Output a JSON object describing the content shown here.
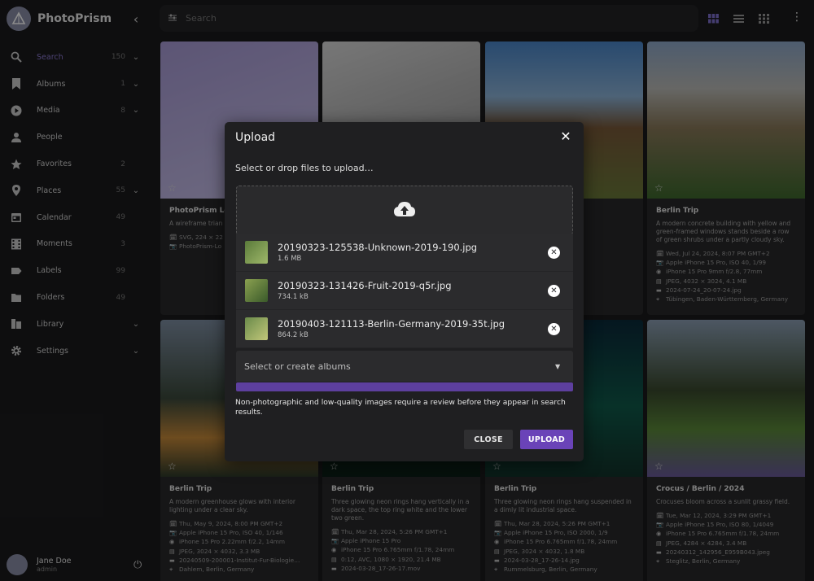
{
  "app": {
    "name": "PhotoPrism"
  },
  "nav": [
    {
      "key": "search",
      "label": "Search",
      "count": "150",
      "chevron": true,
      "active": true
    },
    {
      "key": "albums",
      "label": "Albums",
      "count": "1",
      "chevron": true
    },
    {
      "key": "media",
      "label": "Media",
      "count": "8",
      "chevron": true
    },
    {
      "key": "people",
      "label": "People",
      "count": "",
      "chevron": false
    },
    {
      "key": "favorites",
      "label": "Favorites",
      "count": "2",
      "chevron": false
    },
    {
      "key": "places",
      "label": "Places",
      "count": "55",
      "chevron": true
    },
    {
      "key": "calendar",
      "label": "Calendar",
      "count": "49",
      "chevron": false
    },
    {
      "key": "moments",
      "label": "Moments",
      "count": "3",
      "chevron": false
    },
    {
      "key": "labels",
      "label": "Labels",
      "count": "99",
      "chevron": false
    },
    {
      "key": "folders",
      "label": "Folders",
      "count": "49",
      "chevron": false
    },
    {
      "key": "library",
      "label": "Library",
      "count": "",
      "chevron": true
    },
    {
      "key": "settings",
      "label": "Settings",
      "count": "",
      "chevron": true
    }
  ],
  "user": {
    "name": "Jane Doe",
    "role": "admin"
  },
  "topbar": {
    "search_placeholder": "Search"
  },
  "cards": [
    {
      "title": "PhotoPrism Lo",
      "desc": "A wireframe trian sional geometric",
      "meta": [
        "SVG, 224 × 22",
        "PhotoPrism-Lo"
      ]
    },
    {
      "title": "",
      "desc": "",
      "meta": []
    },
    {
      "title": "",
      "desc": "columns and to the distance",
      "meta": [
        "GMT+2",
        "80, 1/2833",
        "1.78, 24mm",
        "3"
      ]
    },
    {
      "title": "Berlin Trip",
      "desc": "A modern concrete building with yellow and green-framed windows stands beside a row of green shrubs under a partly cloudy sky.",
      "meta": [
        "Wed, Jul 24, 2024, 8:07 PM GMT+2",
        "Apple iPhone 15 Pro, ISO 40, 1/99",
        "iPhone 15 Pro 9mm f/2.8, 77mm",
        "JPEG, 4032 × 3024, 4.1 MB",
        "2024-07-24_20-07-24.jpg",
        "Tübingen, Baden-Württemberg, Germany"
      ]
    },
    {
      "title": "Berlin Trip",
      "desc": "A modern greenhouse glows with interior lighting under a clear sky.",
      "meta": [
        "Thu, May 9, 2024, 8:00 PM GMT+2",
        "Apple iPhone 15 Pro, ISO 40, 1/146",
        "iPhone 15 Pro 2.22mm f/2.2, 14mm",
        "JPEG, 3024 × 4032, 3.3 MB",
        "20240509-200001-Institut-Fur-Biologie…",
        "Dahlem, Berlin, Germany"
      ]
    },
    {
      "title": "Berlin Trip",
      "desc": "Three glowing neon rings hang vertically in a dark space, the top ring white and the lower two green.",
      "meta": [
        "Thu, Mar 28, 2024, 5:26 PM GMT+1",
        "Apple iPhone 15 Pro",
        "iPhone 15 Pro 6.765mm f/1.78, 24mm",
        "0:12, AVC, 1080 × 1920, 21.4 MB",
        "2024-03-28_17-26-17.mov"
      ]
    },
    {
      "title": "Berlin Trip",
      "desc": "Three glowing neon rings hang suspended in a dimly lit industrial space.",
      "meta": [
        "Thu, Mar 28, 2024, 5:26 PM GMT+1",
        "Apple iPhone 15 Pro, ISO 2000, 1/9",
        "iPhone 15 Pro 6.765mm f/1.78, 24mm",
        "JPEG, 3024 × 4032, 1.8 MB",
        "2024-03-28_17-26-14.jpg",
        "Rummelsburg, Berlin, Germany"
      ]
    },
    {
      "title": "Crocus / Berlin / 2024",
      "desc": "Crocuses bloom across a sunlit grassy field.",
      "meta": [
        "Tue, Mar 12, 2024, 3:29 PM GMT+1",
        "Apple iPhone 15 Pro, ISO 80, 1/4049",
        "iPhone 15 Pro 6.765mm f/1.78, 24mm",
        "JPEG, 4284 × 4284, 3.4 MB",
        "20240312_142956_E959B043.jpeg",
        "Steglitz, Berlin, Germany"
      ]
    }
  ],
  "dialog": {
    "title": "Upload",
    "subtitle": "Select or drop files to upload…",
    "files": [
      {
        "name": "20190323-125538-Unknown-2019-190.jpg",
        "size": "1.6 MB"
      },
      {
        "name": "20190323-131426-Fruit-2019-q5r.jpg",
        "size": "734.1 kB"
      },
      {
        "name": "20190403-121113-Berlin-Germany-2019-35t.jpg",
        "size": "864.2 kB"
      }
    ],
    "albums_placeholder": "Select or create albums",
    "progress": 1.0,
    "notice": "Non-photographic and low-quality images require a review before they appear in search results.",
    "close_label": "CLOSE",
    "upload_label": "UPLOAD"
  },
  "colors": {
    "accent": "#6a43b8",
    "active_nav": "#8e7bd6"
  },
  "icons": {
    "upload": "cloud-upload-icon",
    "close": "close-icon",
    "remove": "remove-file-icon"
  }
}
